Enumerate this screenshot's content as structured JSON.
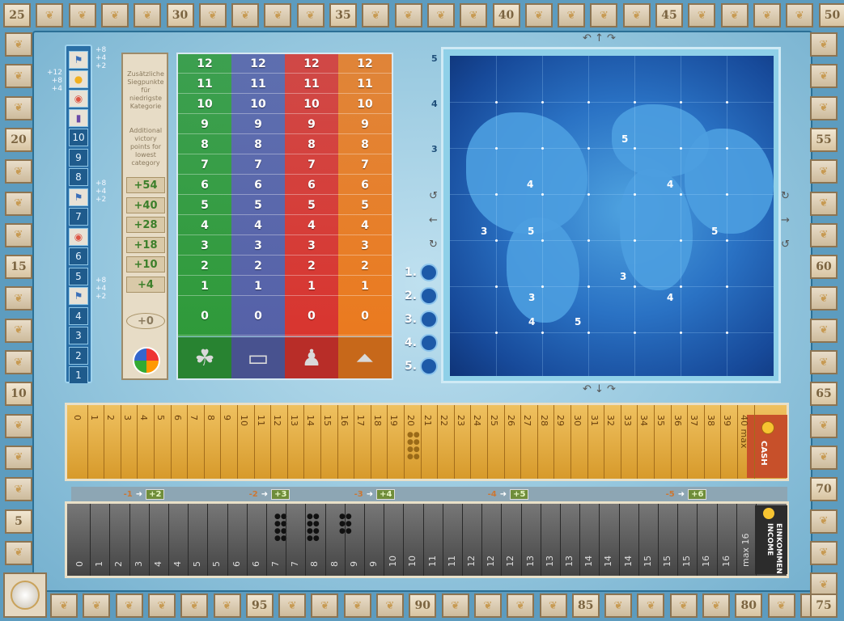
{
  "score_track": {
    "top_numbers": [
      "25",
      "30",
      "35",
      "40",
      "45",
      "50"
    ],
    "right_numbers": [
      "55",
      "60",
      "65",
      "70",
      "75"
    ],
    "bottom_numbers": [
      "80",
      "85",
      "90",
      "95"
    ],
    "left_numbers": [
      "20",
      "15",
      "10",
      "5"
    ]
  },
  "scale": {
    "slots": [
      "10",
      "9",
      "8",
      "7",
      "6",
      "5",
      "4",
      "3",
      "2",
      "1"
    ],
    "bonus_right": [
      "+8",
      "+4",
      "+2"
    ],
    "bonus_left": [
      "+12",
      "+8",
      "+4"
    ]
  },
  "category_label": {
    "german": "Zusätzliche Siegpunkte für niedrigste Kategorie",
    "english": "Additional victory points for lowest category",
    "bonuses": [
      "+54",
      "+40",
      "+28",
      "+18",
      "+10",
      "+4",
      "+0"
    ]
  },
  "category_columns": {
    "values": [
      "12",
      "11",
      "10",
      "9",
      "8",
      "7",
      "6",
      "5",
      "4",
      "3",
      "2",
      "1",
      "0"
    ],
    "colors": [
      "#2f9a3a",
      "#5561a8",
      "#d8352f",
      "#ea7a1f"
    ],
    "icons": [
      "tree-icon",
      "briefcase-icon",
      "person-icon",
      "flask-icon"
    ]
  },
  "map": {
    "side_numbers": [
      "5",
      "4",
      "3"
    ],
    "region_numbers": [
      "5",
      "4",
      "4",
      "3",
      "5",
      "5",
      "3",
      "3",
      "4",
      "4",
      "5"
    ]
  },
  "round_track": [
    "1.",
    "2.",
    "3.",
    "4.",
    "5."
  ],
  "cash_track": {
    "numbers": [
      "0",
      "1",
      "2",
      "3",
      "4",
      "5",
      "6",
      "7",
      "8",
      "9",
      "10",
      "11",
      "12",
      "13",
      "14",
      "15",
      "16",
      "17",
      "18",
      "19",
      "20",
      "21",
      "22",
      "23",
      "24",
      "25",
      "26",
      "27",
      "28",
      "29",
      "30",
      "31",
      "32",
      "33",
      "34",
      "35",
      "36",
      "37",
      "38",
      "39",
      "40 max"
    ],
    "label": "CASH"
  },
  "income_track": {
    "segments": [
      {
        "from": "-1",
        "to": "+2"
      },
      {
        "from": "-2",
        "to": "+3"
      },
      {
        "from": "-3",
        "to": "+4"
      },
      {
        "from": "-4",
        "to": "+5"
      },
      {
        "from": "-5",
        "to": "+6"
      }
    ],
    "numbers": [
      "0",
      "1",
      "2",
      "3",
      "4",
      "4",
      "5",
      "5",
      "6",
      "6",
      "7",
      "7",
      "8",
      "8",
      "9",
      "9",
      "10",
      "10",
      "11",
      "11",
      "12",
      "12",
      "12",
      "13",
      "13",
      "13",
      "14",
      "14",
      "14",
      "15",
      "15",
      "15",
      "16",
      "16",
      "max 16"
    ],
    "label_de": "EINKOMMEN",
    "label_en": "INCOME"
  }
}
